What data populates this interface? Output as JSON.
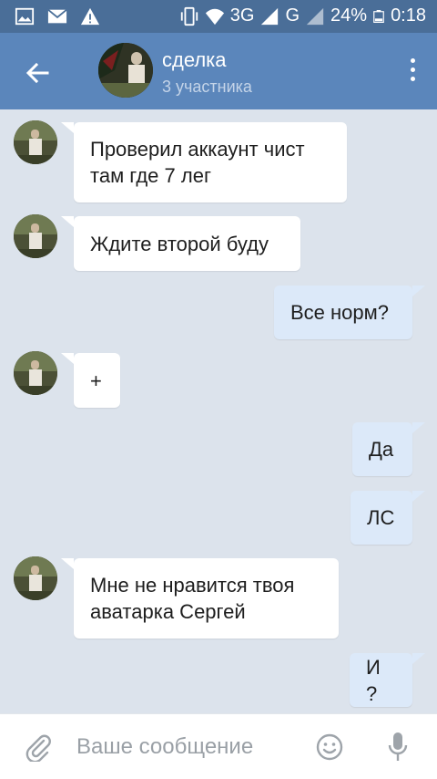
{
  "status_bar": {
    "network_3g": "3G",
    "network_g": "G",
    "battery": "24%",
    "time": "0:18"
  },
  "header": {
    "title": "сделка",
    "subtitle": "3 участника"
  },
  "messages": [
    {
      "direction": "in",
      "lines": [
        "Проверил аккаунт чист",
        "там где 7 лег"
      ]
    },
    {
      "direction": "in",
      "lines": [
        "Ждите второй буду"
      ]
    },
    {
      "direction": "out",
      "lines": [
        "Все норм?"
      ]
    },
    {
      "direction": "in",
      "lines": [
        "+"
      ]
    },
    {
      "direction": "out",
      "lines": [
        "Да"
      ]
    },
    {
      "direction": "out",
      "lines": [
        "ЛС"
      ]
    },
    {
      "direction": "in",
      "lines": [
        "Мне не нравится твоя",
        "аватарка Сергей"
      ]
    },
    {
      "direction": "out",
      "lines": [
        "И ?"
      ]
    }
  ],
  "input": {
    "placeholder": "Ваше сообщение"
  },
  "colors": {
    "status_bar": "#4a6e98",
    "header": "#5b86bb",
    "chat_bg": "#dce3ec",
    "bubble_in": "#ffffff",
    "bubble_out": "#dce9f9"
  }
}
